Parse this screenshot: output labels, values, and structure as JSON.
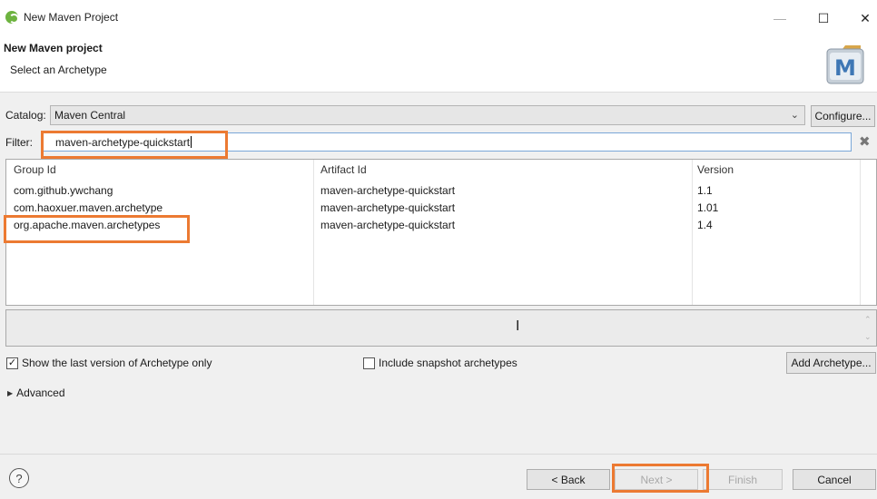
{
  "window": {
    "title": "New Maven Project",
    "controls": {
      "minimize": "—",
      "maximize": "☐",
      "close": "✕"
    }
  },
  "header": {
    "title": "New Maven project",
    "subtitle": "Select an Archetype",
    "logo_letter": "M"
  },
  "catalog": {
    "label": "Catalog:",
    "value": "Maven Central",
    "configure_label": "Configure..."
  },
  "filter": {
    "label": "Filter:",
    "value": "maven-archetype-quickstart"
  },
  "table": {
    "columns": [
      "Group Id",
      "Artifact Id",
      "Version"
    ],
    "rows": [
      [
        "com.github.ywchang",
        "maven-archetype-quickstart",
        "1.1"
      ],
      [
        "com.haoxuer.maven.archetype",
        "maven-archetype-quickstart",
        "1.01"
      ],
      [
        "org.apache.maven.archetypes",
        "maven-archetype-quickstart",
        "1.4"
      ]
    ]
  },
  "options": {
    "last_version_label": "Show the last version of Archetype only",
    "last_version_checked": true,
    "snapshot_label": "Include snapshot archetypes",
    "snapshot_checked": false,
    "add_archetype_label": "Add Archetype...",
    "advanced_label": "Advanced"
  },
  "footer": {
    "help": "?",
    "back_label": "< Back",
    "next_label": "Next >",
    "finish_label": "Finish",
    "cancel_label": "Cancel"
  },
  "colors": {
    "highlight": "#ec7a32",
    "filter_border": "#7aa7d8"
  }
}
